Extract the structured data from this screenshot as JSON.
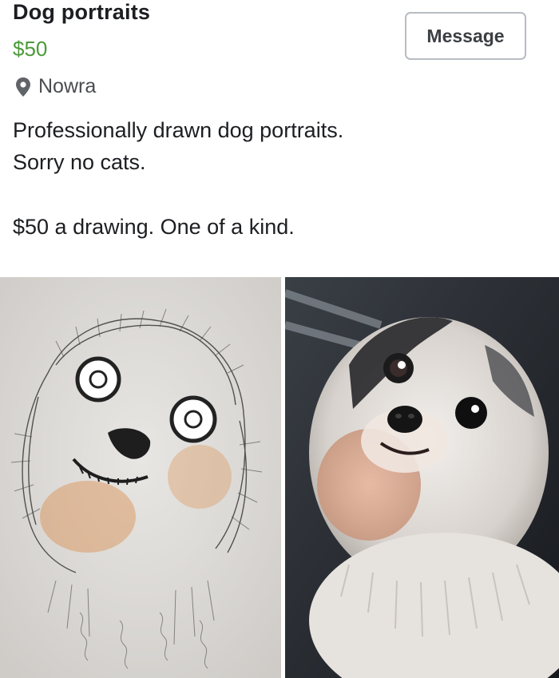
{
  "listing": {
    "title": "Dog portraits",
    "price": "$50",
    "location": "Nowra",
    "message_label": "Message",
    "description": {
      "line1": "Professionally drawn dog portraits.",
      "line2": "Sorry no cats.",
      "line3": "$50 a drawing. One of a kind."
    }
  },
  "icons": {
    "location": "map-pin-icon"
  },
  "colors": {
    "price": "#4c9a3a",
    "text": "#1c1e21",
    "muted": "#4a4c50",
    "button_border": "#b8bcc3"
  }
}
